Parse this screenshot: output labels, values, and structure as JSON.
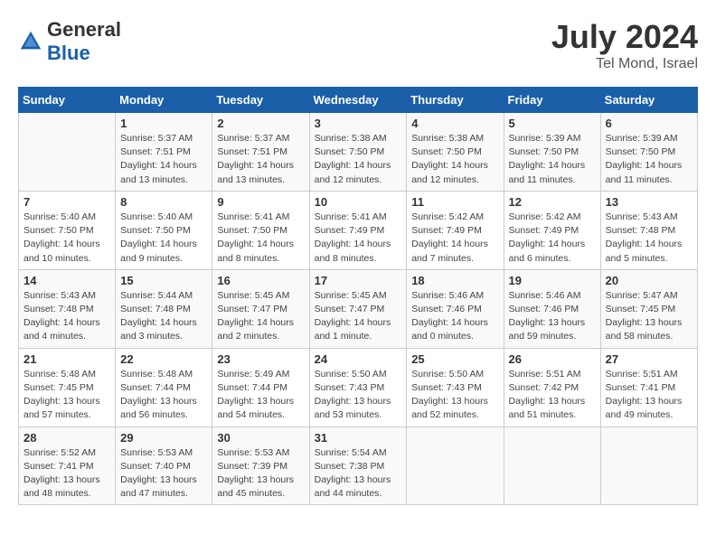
{
  "header": {
    "logo_general": "General",
    "logo_blue": "Blue",
    "title": "July 2024",
    "location": "Tel Mond, Israel"
  },
  "columns": [
    "Sunday",
    "Monday",
    "Tuesday",
    "Wednesday",
    "Thursday",
    "Friday",
    "Saturday"
  ],
  "weeks": [
    [
      {
        "day": "",
        "info": ""
      },
      {
        "day": "1",
        "info": "Sunrise: 5:37 AM\nSunset: 7:51 PM\nDaylight: 14 hours\nand 13 minutes."
      },
      {
        "day": "2",
        "info": "Sunrise: 5:37 AM\nSunset: 7:51 PM\nDaylight: 14 hours\nand 13 minutes."
      },
      {
        "day": "3",
        "info": "Sunrise: 5:38 AM\nSunset: 7:50 PM\nDaylight: 14 hours\nand 12 minutes."
      },
      {
        "day": "4",
        "info": "Sunrise: 5:38 AM\nSunset: 7:50 PM\nDaylight: 14 hours\nand 12 minutes."
      },
      {
        "day": "5",
        "info": "Sunrise: 5:39 AM\nSunset: 7:50 PM\nDaylight: 14 hours\nand 11 minutes."
      },
      {
        "day": "6",
        "info": "Sunrise: 5:39 AM\nSunset: 7:50 PM\nDaylight: 14 hours\nand 11 minutes."
      }
    ],
    [
      {
        "day": "7",
        "info": "Sunrise: 5:40 AM\nSunset: 7:50 PM\nDaylight: 14 hours\nand 10 minutes."
      },
      {
        "day": "8",
        "info": "Sunrise: 5:40 AM\nSunset: 7:50 PM\nDaylight: 14 hours\nand 9 minutes."
      },
      {
        "day": "9",
        "info": "Sunrise: 5:41 AM\nSunset: 7:50 PM\nDaylight: 14 hours\nand 8 minutes."
      },
      {
        "day": "10",
        "info": "Sunrise: 5:41 AM\nSunset: 7:49 PM\nDaylight: 14 hours\nand 8 minutes."
      },
      {
        "day": "11",
        "info": "Sunrise: 5:42 AM\nSunset: 7:49 PM\nDaylight: 14 hours\nand 7 minutes."
      },
      {
        "day": "12",
        "info": "Sunrise: 5:42 AM\nSunset: 7:49 PM\nDaylight: 14 hours\nand 6 minutes."
      },
      {
        "day": "13",
        "info": "Sunrise: 5:43 AM\nSunset: 7:48 PM\nDaylight: 14 hours\nand 5 minutes."
      }
    ],
    [
      {
        "day": "14",
        "info": "Sunrise: 5:43 AM\nSunset: 7:48 PM\nDaylight: 14 hours\nand 4 minutes."
      },
      {
        "day": "15",
        "info": "Sunrise: 5:44 AM\nSunset: 7:48 PM\nDaylight: 14 hours\nand 3 minutes."
      },
      {
        "day": "16",
        "info": "Sunrise: 5:45 AM\nSunset: 7:47 PM\nDaylight: 14 hours\nand 2 minutes."
      },
      {
        "day": "17",
        "info": "Sunrise: 5:45 AM\nSunset: 7:47 PM\nDaylight: 14 hours\nand 1 minute."
      },
      {
        "day": "18",
        "info": "Sunrise: 5:46 AM\nSunset: 7:46 PM\nDaylight: 14 hours\nand 0 minutes."
      },
      {
        "day": "19",
        "info": "Sunrise: 5:46 AM\nSunset: 7:46 PM\nDaylight: 13 hours\nand 59 minutes."
      },
      {
        "day": "20",
        "info": "Sunrise: 5:47 AM\nSunset: 7:45 PM\nDaylight: 13 hours\nand 58 minutes."
      }
    ],
    [
      {
        "day": "21",
        "info": "Sunrise: 5:48 AM\nSunset: 7:45 PM\nDaylight: 13 hours\nand 57 minutes."
      },
      {
        "day": "22",
        "info": "Sunrise: 5:48 AM\nSunset: 7:44 PM\nDaylight: 13 hours\nand 56 minutes."
      },
      {
        "day": "23",
        "info": "Sunrise: 5:49 AM\nSunset: 7:44 PM\nDaylight: 13 hours\nand 54 minutes."
      },
      {
        "day": "24",
        "info": "Sunrise: 5:50 AM\nSunset: 7:43 PM\nDaylight: 13 hours\nand 53 minutes."
      },
      {
        "day": "25",
        "info": "Sunrise: 5:50 AM\nSunset: 7:43 PM\nDaylight: 13 hours\nand 52 minutes."
      },
      {
        "day": "26",
        "info": "Sunrise: 5:51 AM\nSunset: 7:42 PM\nDaylight: 13 hours\nand 51 minutes."
      },
      {
        "day": "27",
        "info": "Sunrise: 5:51 AM\nSunset: 7:41 PM\nDaylight: 13 hours\nand 49 minutes."
      }
    ],
    [
      {
        "day": "28",
        "info": "Sunrise: 5:52 AM\nSunset: 7:41 PM\nDaylight: 13 hours\nand 48 minutes."
      },
      {
        "day": "29",
        "info": "Sunrise: 5:53 AM\nSunset: 7:40 PM\nDaylight: 13 hours\nand 47 minutes."
      },
      {
        "day": "30",
        "info": "Sunrise: 5:53 AM\nSunset: 7:39 PM\nDaylight: 13 hours\nand 45 minutes."
      },
      {
        "day": "31",
        "info": "Sunrise: 5:54 AM\nSunset: 7:38 PM\nDaylight: 13 hours\nand 44 minutes."
      },
      {
        "day": "",
        "info": ""
      },
      {
        "day": "",
        "info": ""
      },
      {
        "day": "",
        "info": ""
      }
    ]
  ]
}
